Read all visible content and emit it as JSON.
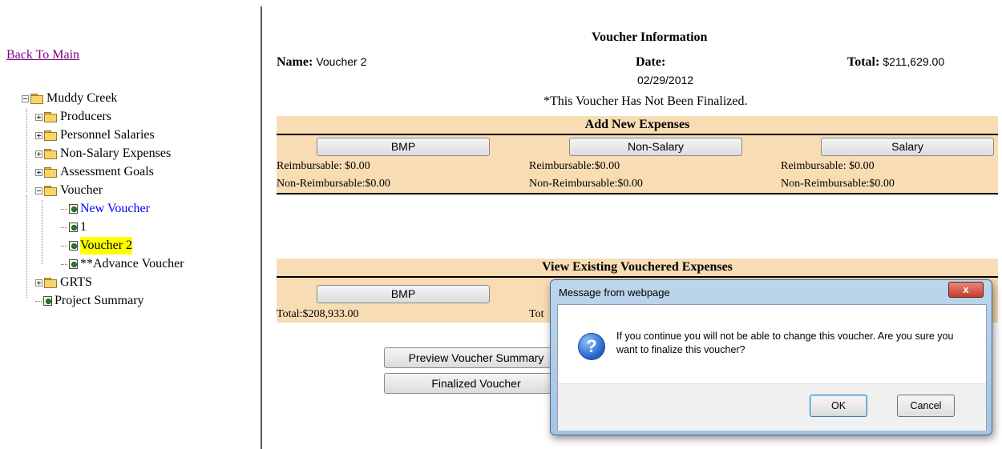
{
  "left": {
    "back_link": "Back To Main",
    "tree": {
      "root": "Muddy Creek",
      "producers": "Producers",
      "personnel_salaries": "Personnel Salaries",
      "non_salary_expenses": "Non-Salary Expenses",
      "assessment_goals": "Assessment Goals",
      "voucher": "Voucher",
      "new_voucher": "New Voucher",
      "voucher_1": "1",
      "voucher_2": "Voucher 2",
      "advance_voucher": "**Advance Voucher",
      "grts": "GRTS",
      "project_summary": "Project Summary"
    }
  },
  "voucher": {
    "title": "Voucher Information",
    "name_label": "Name:",
    "name_value": "Voucher 2",
    "date_label": "Date:",
    "date_value": "02/29/2012",
    "total_label": "Total:",
    "total_value": "$211,629.00",
    "not_finalized": "*This Voucher Has Not Been Finalized."
  },
  "add_expenses": {
    "title": "Add New Expenses",
    "bmp_button": "BMP",
    "nonsalary_button": "Non-Salary",
    "salary_button": "Salary",
    "bmp_reimbursable": "Reimbursable: $0.00",
    "bmp_nonreimbursable": "Non-Reimbursable:$0.00",
    "nonsalary_reimbursable": "Reimbursable:$0.00",
    "nonsalary_nonreimbursable": "Non-Reimbursable:$0.00",
    "salary_reimbursable": "Reimbursable: $0.00",
    "salary_nonreimbursable": "Non-Reimbursable:$0.00"
  },
  "view_expenses": {
    "title": "View Existing Vouchered Expenses",
    "bmp_button": "BMP",
    "bmp_total": "Total:$208,933.00",
    "middle_total_partial": "Tot"
  },
  "actions": {
    "preview_button": "Preview Voucher Summary",
    "finalize_button": "Finalized Voucher"
  },
  "dialog": {
    "title": "Message from webpage",
    "close_label": "x",
    "message": "If you continue you will not be able to change this voucher.  Are you sure you want to finalize this voucher?",
    "icon": "question-icon",
    "ok_label": "OK",
    "cancel_label": "Cancel"
  },
  "colors": {
    "band_background": "#f7dcb4",
    "selected_highlight": "#ffff00",
    "link_blue": "#0000ff",
    "visited_link": "#800080"
  }
}
